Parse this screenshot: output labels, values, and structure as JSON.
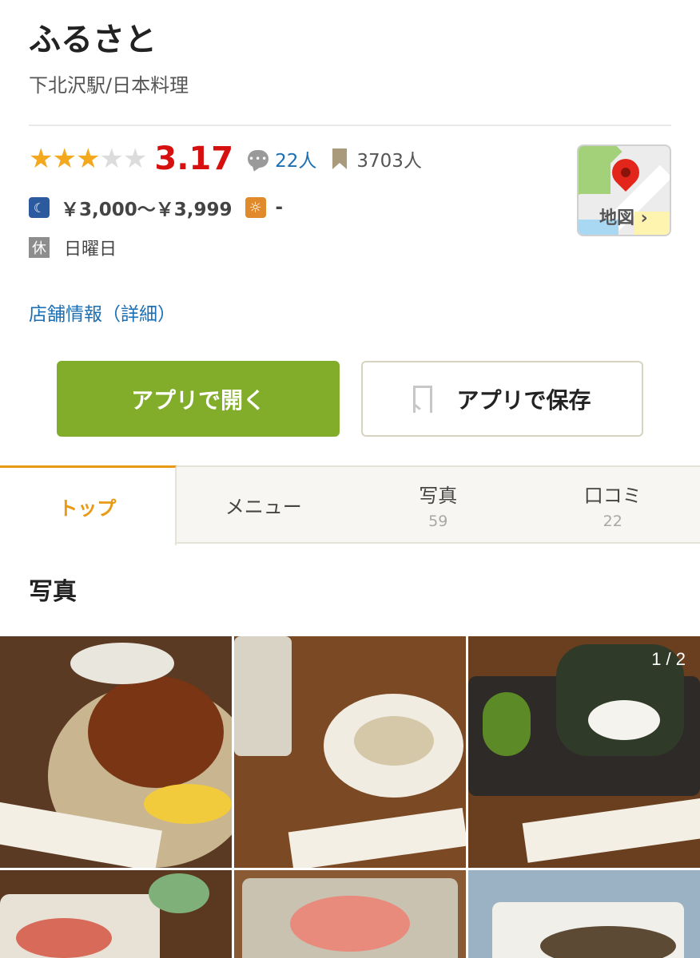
{
  "shop": {
    "name": "ふるさと",
    "sub": "下北沢駅/日本料理"
  },
  "rating": {
    "score": "3.17",
    "stars_filled": 3,
    "stars_total": 5,
    "review_count": "22人",
    "bookmark_count": "3703人"
  },
  "price": {
    "dinner": "￥3,000〜￥3,999",
    "lunch": "-"
  },
  "holiday": {
    "badge": "休",
    "text": "日曜日"
  },
  "map": {
    "label": "地図 ›"
  },
  "detail_link": "店舗情報（詳細）",
  "actions": {
    "open_label": "アプリで開く",
    "save_label": "アプリで保存"
  },
  "tabs": [
    {
      "label": "トップ",
      "count": ""
    },
    {
      "label": "メニュー",
      "count": ""
    },
    {
      "label": "写真",
      "count": "59"
    },
    {
      "label": "口コミ",
      "count": "22"
    }
  ],
  "photos": {
    "section_title": "写真",
    "counter": "1 / 2"
  },
  "colors": {
    "accent_orange": "#e89a14",
    "score_red": "#d60f0f",
    "open_button_green": "#82ad2b",
    "link_blue": "#1a6fb5",
    "star_gold": "#f4a81d"
  },
  "icons": [
    "review-icon",
    "bookmark-icon",
    "moon-icon",
    "sun-icon",
    "map-pin-icon",
    "save-bookmark-icon"
  ]
}
